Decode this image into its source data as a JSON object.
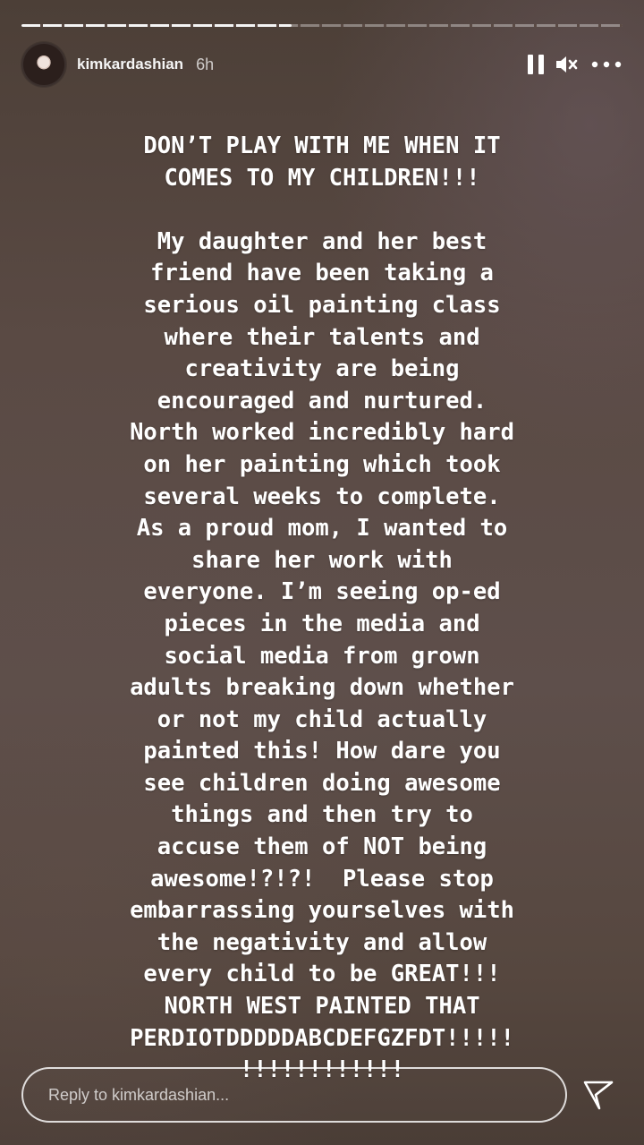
{
  "story": {
    "progress_fraction": 0.45,
    "author": {
      "username": "kimkardashian",
      "time_posted": "6h"
    },
    "controls": {
      "pause_icon": "pause-icon",
      "mute_icon": "speaker-muted-icon",
      "more_icon": "more-options-icon"
    },
    "lines": [
      "DON’T PLAY WITH ME WHEN IT",
      "COMES TO MY CHILDREN!!!",
      "",
      "My daughter and her best",
      "friend have been taking a",
      "serious oil painting class",
      "where their talents and",
      "creativity are being",
      "encouraged and nurtured.",
      "North worked incredibly hard",
      "on her painting which took",
      "several weeks to complete.",
      "As a proud mom, I wanted to",
      "share her work with",
      "everyone. I’m seeing op-ed",
      "pieces in the media and",
      "social media from grown",
      "adults breaking down whether",
      "or not my child actually",
      "painted this! How dare you",
      "see children doing awesome",
      "things and then try to",
      "accuse them of NOT being",
      "awesome!?!?!  Please stop",
      "embarrassing yourselves with",
      "the negativity and allow",
      "every child to be GREAT!!!",
      "NORTH WEST PAINTED THAT",
      "PERDIOTDDDDDABCDEFGZFDT!!!!!",
      "!!!!!!!!!!!!"
    ]
  },
  "reply": {
    "placeholder": "Reply to kimkardashian...",
    "send_icon": "send-icon"
  },
  "colors": {
    "text": "#ffffff",
    "background": "#5a4a44"
  }
}
